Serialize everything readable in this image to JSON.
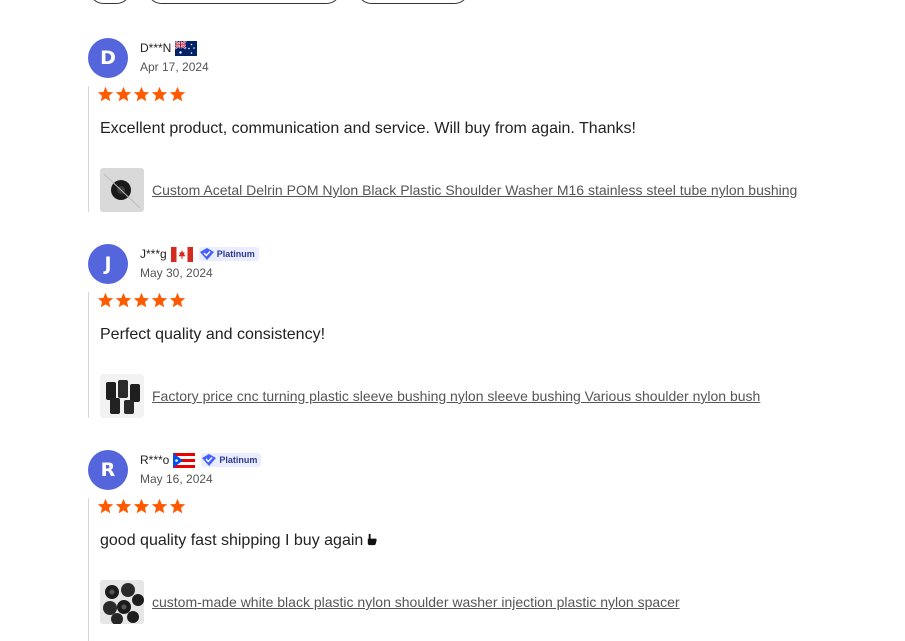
{
  "reviews": [
    {
      "initial": "D",
      "name": "D***N",
      "flag": "australia-flag-icon",
      "badge": "",
      "date": "Apr 17, 2024",
      "rating": 5,
      "comment": "Excellent product, communication and service. Will buy from again. Thanks!",
      "product": "Custom Acetal Delrin POM Nylon Black Plastic Shoulder Washer M16 stainless steel tube nylon bushing"
    },
    {
      "initial": "J",
      "name": "J***g",
      "flag": "canada-flag-icon",
      "badge": "Platinum",
      "date": "May 30, 2024",
      "rating": 5,
      "comment": "Perfect quality and consistency!",
      "product": "Factory price cnc turning plastic sleeve bushing nylon sleeve bushing Various shoulder nylon bush"
    },
    {
      "initial": "R",
      "name": "R***o",
      "flag": "puerto-rico-flag-icon",
      "badge": "Platinum",
      "date": "May 16, 2024",
      "rating": 5,
      "comment": "good quality fast shipping I buy again",
      "comment_emoji": "thumbs-up-icon",
      "product": "custom-made white black plastic nylon shoulder washer injection plastic nylon spacer"
    }
  ],
  "colors": {
    "avatar_bg": "#5566dd",
    "star": "#ff5a00",
    "badge_bg": "#e9edff",
    "badge_text": "#2d3a8c",
    "link": "#555555"
  }
}
